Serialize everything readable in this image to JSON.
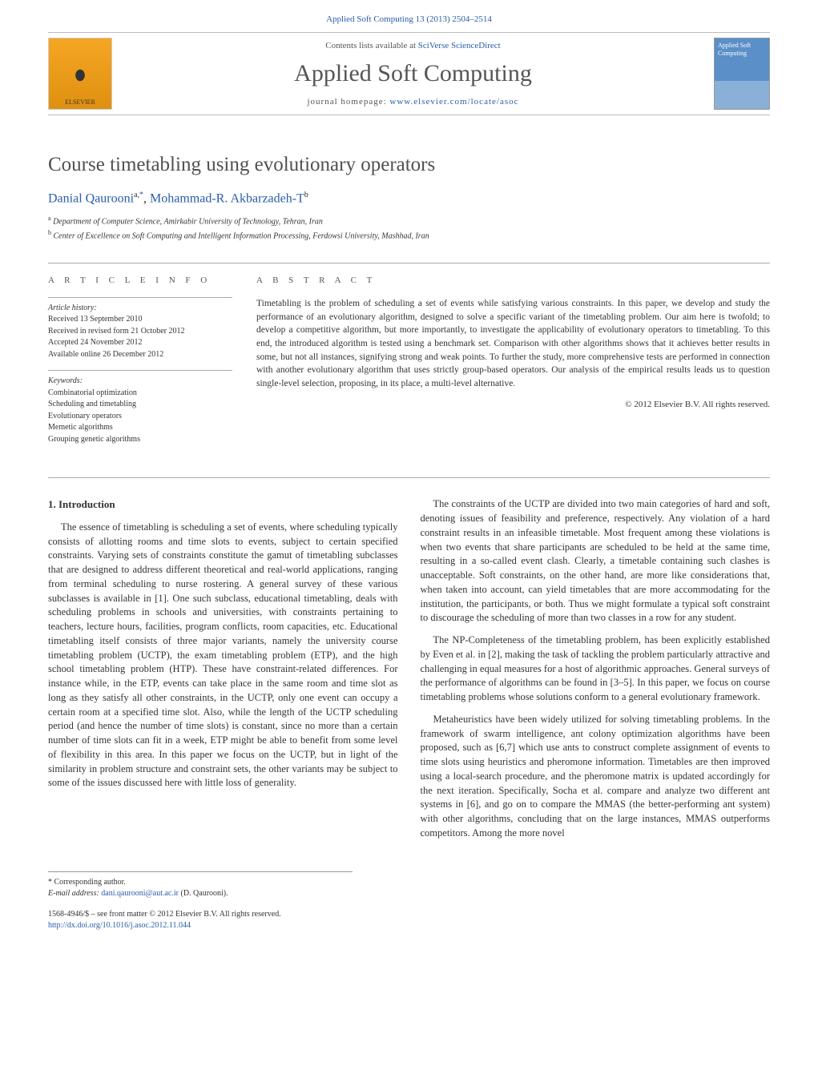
{
  "header": {
    "citation_prefix": "Applied Soft Computing 13 (2013) 2504–2514",
    "contents_line_prefix": "Contents lists available at ",
    "contents_link": "SciVerse ScienceDirect",
    "journal_name": "Applied Soft Computing",
    "homepage_prefix": "journal homepage: ",
    "homepage_link": "www.elsevier.com/locate/asoc",
    "publisher_name": "ELSEVIER",
    "cover_text": "Applied Soft Computing"
  },
  "article": {
    "title": "Course timetabling using evolutionary operators",
    "authors_html_a1": "Danial Qaurooni",
    "authors_sup1": "a,",
    "authors_star": "*",
    "authors_sep": ", ",
    "authors_html_a2": "Mohammad-R. Akbarzadeh-T",
    "authors_sup2": "b",
    "affiliation_a_sup": "a",
    "affiliation_a": " Department of Computer Science, Amirkabir University of Technology, Tehran, Iran",
    "affiliation_b_sup": "b",
    "affiliation_b": " Center of Excellence on Soft Computing and Intelligent Information Processing, Ferdowsi University, Mashhad, Iran"
  },
  "info": {
    "heading": "a r t i c l e   i n f o",
    "history_label": "Article history:",
    "received": "Received 13 September 2010",
    "revised": "Received in revised form 21 October 2012",
    "accepted": "Accepted 24 November 2012",
    "online": "Available online 26 December 2012",
    "keywords_label": "Keywords:",
    "kw1": "Combinatorial optimization",
    "kw2": "Scheduling and timetabling",
    "kw3": "Evolutionary operators",
    "kw4": "Memetic algorithms",
    "kw5": "Grouping genetic algorithms"
  },
  "abstract": {
    "heading": "a b s t r a c t",
    "text": "Timetabling is the problem of scheduling a set of events while satisfying various constraints. In this paper, we develop and study the performance of an evolutionary algorithm, designed to solve a specific variant of the timetabling problem. Our aim here is twofold; to develop a competitive algorithm, but more importantly, to investigate the applicability of evolutionary operators to timetabling. To this end, the introduced algorithm is tested using a benchmark set. Comparison with other algorithms shows that it achieves better results in some, but not all instances, signifying strong and weak points. To further the study, more comprehensive tests are performed in connection with another evolutionary algorithm that uses strictly group-based operators. Our analysis of the empirical results leads us to question single-level selection, proposing, in its place, a multi-level alternative.",
    "copyright": "© 2012 Elsevier B.V. All rights reserved."
  },
  "body": {
    "section1_heading": "1. Introduction",
    "col1_p1": "The essence of timetabling is scheduling a set of events, where scheduling typically consists of allotting rooms and time slots to events, subject to certain specified constraints. Varying sets of constraints constitute the gamut of timetabling subclasses that are designed to address different theoretical and real-world applications, ranging from terminal scheduling to nurse rostering. A general survey of these various subclasses is available in [1]. One such subclass, educational timetabling, deals with scheduling problems in schools and universities, with constraints pertaining to teachers, lecture hours, facilities, program conflicts, room capacities, etc. Educational timetabling itself consists of three major variants, namely the university course timetabling problem (UCTP), the exam timetabling problem (ETP), and the high school timetabling problem (HTP). These have constraint-related differences. For instance while, in the ETP, events can take place in the same room and time slot as long as they satisfy all other constraints, in the UCTP, only one event can occupy a certain room at a specified time slot. Also, while the length of the UCTP scheduling period (and hence the number of time slots) is constant, since no more than a certain number of time slots can fit in a week, ETP might be able to benefit from some level of flexibility in this area. In this paper we focus on the UCTP, but in light of the similarity in problem structure and constraint sets, the other variants may be subject to some of the issues discussed here with little loss of generality.",
    "col2_p1": "The constraints of the UCTP are divided into two main categories of hard and soft, denoting issues of feasibility and preference, respectively. Any violation of a hard constraint results in an infeasible timetable. Most frequent among these violations is when two events that share participants are scheduled to be held at the same time, resulting in a so-called event clash. Clearly, a timetable containing such clashes is unacceptable. Soft constraints, on the other hand, are more like considerations that, when taken into account, can yield timetables that are more accommodating for the institution, the participants, or both. Thus we might formulate a typical soft constraint to discourage the scheduling of more than two classes in a row for any student.",
    "col2_p2": "The NP-Completeness of the timetabling problem, has been explicitly established by Even et al. in [2], making the task of tackling the problem particularly attractive and challenging in equal measures for a host of algorithmic approaches. General surveys of the performance of algorithms can be found in [3–5]. In this paper, we focus on course timetabling problems whose solutions conform to a general evolutionary framework.",
    "col2_p3": "Metaheuristics have been widely utilized for solving timetabling problems. In the framework of swarm intelligence, ant colony optimization algorithms have been proposed, such as [6,7] which use ants to construct complete assignment of events to time slots using heuristics and pheromone information. Timetables are then improved using a local-search procedure, and the pheromone matrix is updated accordingly for the next iteration. Specifically, Socha et al. compare and analyze two different ant systems in [6], and go on to compare the MMAS (the better-performing ant system) with other algorithms, concluding that on the large instances, MMAS outperforms competitors. Among the more novel"
  },
  "footnotes": {
    "corr_label": "* Corresponding author.",
    "email_label": "E-mail address: ",
    "email": "dani.qaurooni@aut.ac.ir",
    "email_name": " (D. Qaurooni)."
  },
  "footer": {
    "issn_line": "1568-4946/$ – see front matter © 2012 Elsevier B.V. All rights reserved.",
    "doi_link": "http://dx.doi.org/10.1016/j.asoc.2012.11.044"
  }
}
